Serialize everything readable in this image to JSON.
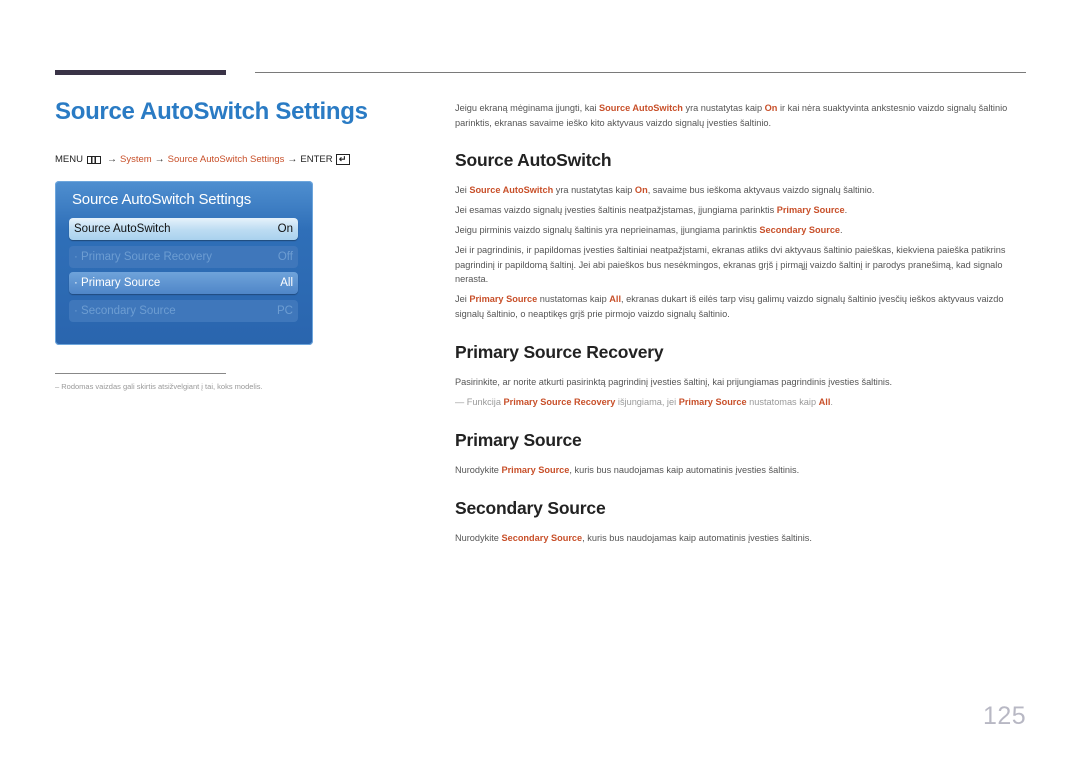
{
  "header": {
    "title": "Source AutoSwitch Settings"
  },
  "menu_path": {
    "menu": "MENU",
    "menu_icon": "menu-grid-icon",
    "arrow": "→",
    "step1": "System",
    "step2": "Source AutoSwitch Settings",
    "enter": "ENTER",
    "enter_icon": "enter-icon",
    "enter_glyph": "↵"
  },
  "osd": {
    "title": "Source AutoSwitch Settings",
    "items": [
      {
        "label": "Source AutoSwitch",
        "value": "On",
        "state": "selected"
      },
      {
        "label": "· Primary Source Recovery",
        "value": "Off",
        "state": "disabled"
      },
      {
        "label": "· Primary Source",
        "value": "All",
        "state": "enabled"
      },
      {
        "label": "· Secondary Source",
        "value": "PC",
        "state": "disabled"
      }
    ]
  },
  "footnote": "–  Rodomas vaizdas gali skirtis atsižvelgiant į tai, koks modelis.",
  "intro": {
    "t1": "Jeigu ekraną mėginama įjungti, kai ",
    "h1": "Source AutoSwitch",
    "t2": " yra nustatytas kaip ",
    "h2": "On",
    "t3": " ir kai nėra suaktyvinta ankstesnio vaizdo signalų šaltinio parinktis, ekranas savaime ieško kito aktyvaus vaizdo signalų įvesties šaltinio."
  },
  "sections": {
    "source_autoswitch": {
      "heading": "Source AutoSwitch",
      "p1": {
        "t1": "Jei ",
        "h1": "Source AutoSwitch",
        "t2": " yra nustatytas kaip ",
        "h2": "On",
        "t3": ", savaime bus ieškoma aktyvaus vaizdo signalų šaltinio."
      },
      "p2": {
        "t1": "Jei esamas vaizdo signalų įvesties šaltinis neatpažįstamas, įjungiama parinktis ",
        "h1": "Primary Source",
        "t2": "."
      },
      "p3": {
        "t1": "Jeigu pirminis vaizdo signalų šaltinis yra neprieinamas, įjungiama parinktis ",
        "h1": "Secondary Source",
        "t2": "."
      },
      "p4": "Jei ir pagrindinis, ir papildomas įvesties šaltiniai neatpažįstami, ekranas atliks dvi aktyvaus šaltinio paieškas, kiekviena paieška patikrins pagrindinį ir papildomą šaltinį. Jei abi paieškos bus nesėkmingos, ekranas grįš į pirmąjį vaizdo šaltinį ir parodys pranešimą, kad signalo nerasta.",
      "p5": {
        "t1": "Jei ",
        "h1": "Primary Source",
        "t2": " nustatomas kaip ",
        "h2": "All",
        "t3": ", ekranas dukart iš eilės tarp visų galimų vaizdo signalų šaltinio įvesčių ieškos aktyvaus vaizdo signalų šaltinio, o neaptikęs grįš prie pirmojo vaizdo signalų šaltinio."
      }
    },
    "primary_source_recovery": {
      "heading": "Primary Source Recovery",
      "p1": "Pasirinkite, ar norite atkurti pasirinktą pagrindinį įvesties šaltinį, kai prijungiamas pagrindinis įvesties šaltinis.",
      "note": {
        "dash": "—",
        "t1": " Funkcija ",
        "h1": "Primary Source Recovery",
        "t2": " išjungiama, jei ",
        "h2": "Primary Source",
        "t3": " nustatomas kaip ",
        "h3": "All",
        "t4": "."
      }
    },
    "primary_source": {
      "heading": "Primary Source",
      "p1": {
        "t1": "Nurodykite ",
        "h1": "Primary Source",
        "t2": ", kuris bus naudojamas kaip automatinis įvesties šaltinis."
      }
    },
    "secondary_source": {
      "heading": "Secondary Source",
      "p1": {
        "t1": "Nurodykite ",
        "h1": "Secondary Source",
        "t2": ", kuris bus naudojamas kaip automatinis įvesties šaltinis."
      }
    }
  },
  "page_number": "125",
  "colors": {
    "title_blue": "#2a7bc4",
    "highlight_orange": "#c8502a",
    "top_bar": "#3a3347",
    "osd_blue": "#2f6fb8"
  }
}
